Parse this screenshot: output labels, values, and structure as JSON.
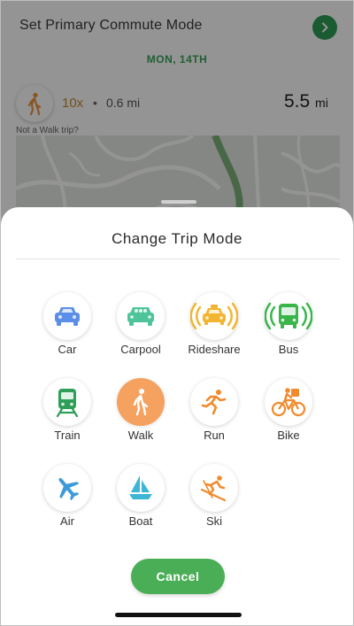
{
  "background": {
    "title": "Set Primary Commute Mode",
    "date": "MON, 14TH",
    "trip": {
      "multiplier": "10x",
      "separator": "•",
      "distance": "0.6 mi",
      "total_value": "5.5",
      "total_unit": "mi",
      "not_mode_link": "Not a Walk trip?"
    }
  },
  "sheet": {
    "title": "Change Trip Mode",
    "modes": [
      {
        "label": "Car",
        "icon": "car-icon",
        "color": "#5b8ee6"
      },
      {
        "label": "Carpool",
        "icon": "carpool-icon",
        "color": "#4fc49a"
      },
      {
        "label": "Rideshare",
        "icon": "rideshare-icon",
        "color": "#f2b531"
      },
      {
        "label": "Bus",
        "icon": "bus-icon",
        "color": "#39b54a"
      },
      {
        "label": "Train",
        "icon": "train-icon",
        "color": "#2e9e58"
      },
      {
        "label": "Walk",
        "icon": "walk-icon",
        "color": "#f5a15f",
        "selected": true
      },
      {
        "label": "Run",
        "icon": "run-icon",
        "color": "#f08a2c"
      },
      {
        "label": "Bike",
        "icon": "bike-icon",
        "color": "#f08a2c"
      },
      {
        "label": "Air",
        "icon": "airplane-icon",
        "color": "#3d9ad9"
      },
      {
        "label": "Boat",
        "icon": "boat-icon",
        "color": "#3cb6d4"
      },
      {
        "label": "Ski",
        "icon": "ski-icon",
        "color": "#f08a2c"
      }
    ],
    "cancel_label": "Cancel"
  }
}
